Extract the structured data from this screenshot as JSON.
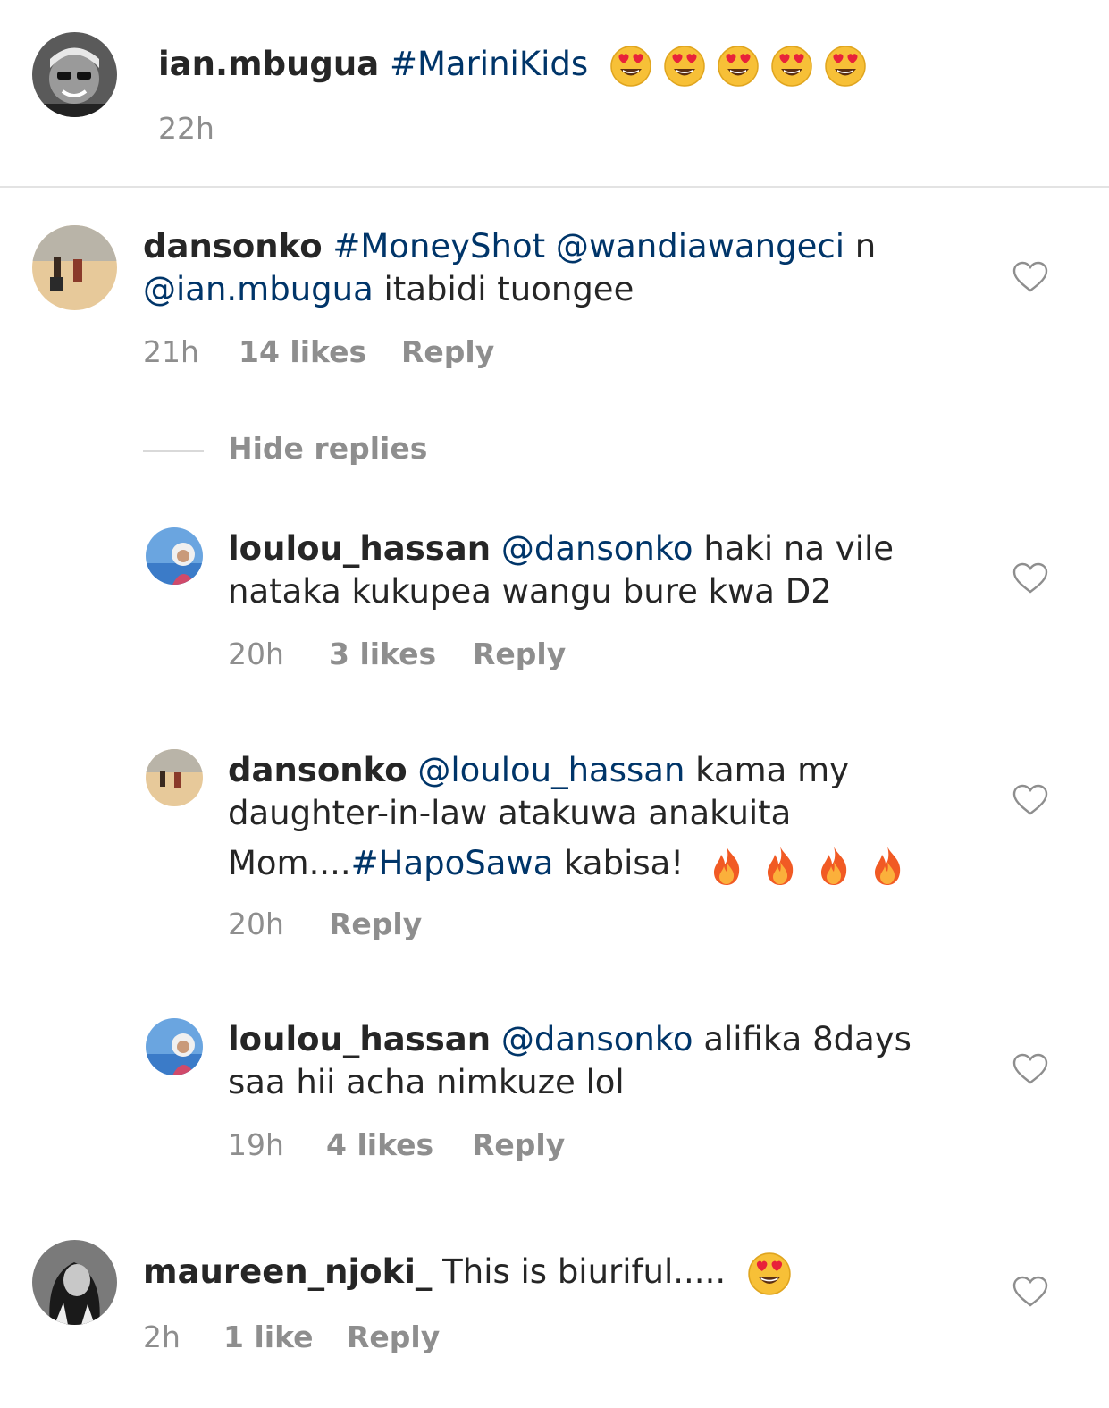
{
  "caption": {
    "username": "ian.mbugua",
    "hashtag": "#MariniKids",
    "emoji": "heart-eyes-emoji",
    "emoji_count": 5,
    "time": "22h"
  },
  "comments": [
    {
      "username": "dansonko",
      "line1_link1": "#MoneyShot",
      "line1_link2": "@wandiawangeci",
      "line1_tail": " n",
      "line2_link": "@ian.mbugua",
      "line2_tail": " itabidi tuongee",
      "time": "21h",
      "likes": "14 likes",
      "reply": "Reply"
    }
  ],
  "hide_replies": "Hide replies",
  "replies": [
    {
      "username": "loulou_hassan",
      "mention": "@dansonko",
      "line1_tail": " haki na vile",
      "line2": "nataka kukupea wangu bure kwa D2",
      "time": "20h",
      "likes": "3 likes",
      "reply": "Reply"
    },
    {
      "username": "dansonko",
      "mention": "@loulou_hassan",
      "line1_tail": " kama my",
      "line2": "daughter-in-law atakuwa anakuita",
      "line3_head": "Mom....",
      "line3_hashtag": "#HapoSawa",
      "line3_tail": " kabisa!",
      "emoji": "fire-emoji",
      "emoji_count": 4,
      "time": "20h",
      "reply": "Reply"
    },
    {
      "username": "loulou_hassan",
      "mention": "@dansonko",
      "line1_tail": " alifika 8days",
      "line2": "saa hii acha nimkuze lol",
      "time": "19h",
      "likes": "4 likes",
      "reply": "Reply"
    }
  ],
  "last_comment": {
    "username": "maureen_njoki_",
    "text": " This is biuriful.....",
    "emoji": "heart-eyes-emoji",
    "time": "2h",
    "likes": "1 like",
    "reply": "Reply"
  },
  "colors": {
    "text": "#262626",
    "link": "#003569",
    "meta": "#8e8e8e",
    "divider": "#e3e3e3"
  }
}
